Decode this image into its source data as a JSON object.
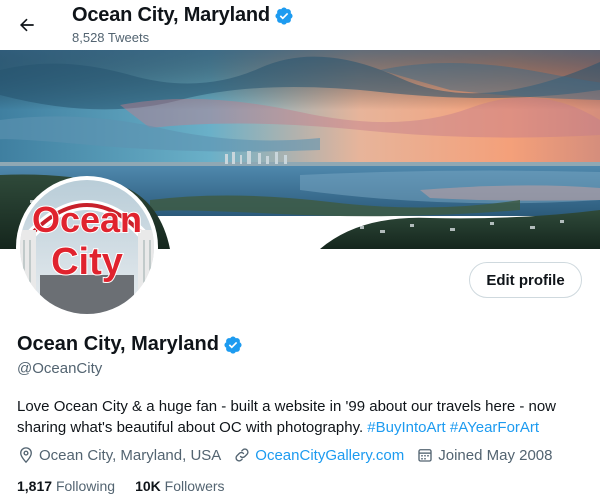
{
  "header": {
    "name": "Ocean City, Maryland",
    "tweet_count": "8,528 Tweets"
  },
  "profile": {
    "avatar_text_top": "Ocean",
    "avatar_text_bottom": "City",
    "edit_button": "Edit profile",
    "name": "Ocean City, Maryland",
    "handle": "@OceanCity",
    "bio_text": "Love Ocean City & a huge fan - built a website in '99 about our travels here - now sharing what's beautiful about OC with photography. ",
    "bio_tags": [
      "#BuyIntoArt",
      "#AYearForArt"
    ],
    "location": "Ocean City, Maryland, USA",
    "website": "OceanCityGallery.com",
    "joined": "Joined May 2008",
    "following_count": "1,817",
    "following_label": "Following",
    "followers_count": "10K",
    "followers_label": "Followers"
  },
  "colors": {
    "accent": "#1d9bf0",
    "secondary_text": "#536471",
    "primary_text": "#0f1419"
  }
}
